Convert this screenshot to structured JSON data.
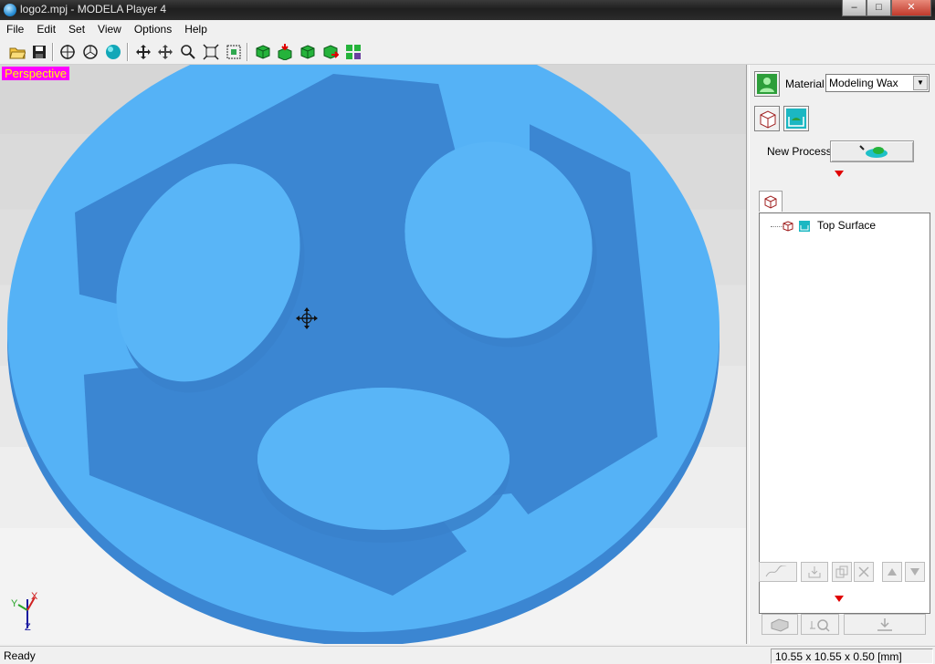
{
  "window": {
    "title": "logo2.mpj - MODELA Player 4",
    "min_label": "–",
    "max_label": "□",
    "close_label": "✕"
  },
  "menu": [
    "File",
    "Edit",
    "Set",
    "View",
    "Options",
    "Help"
  ],
  "toolbar": {
    "buttons": [
      "open-icon",
      "save-icon",
      "view-front-icon",
      "view-side-icon",
      "sphere-render-icon",
      "move-icon",
      "pan-icon",
      "zoom-icon",
      "fit-icon",
      "zoom-box-icon",
      "cube-green-icon",
      "cube-down-icon",
      "cube-right-icon",
      "cube-red-icon",
      "grid-icon"
    ]
  },
  "viewport": {
    "label": "Perspective",
    "axis": {
      "x": "X",
      "y": "Y",
      "z": "Z"
    }
  },
  "panel": {
    "material_label": "Material",
    "material_value": "Modeling Wax",
    "new_process_label": "New Process",
    "tree": [
      {
        "label": "Top Surface"
      }
    ]
  },
  "status": {
    "text": "Ready",
    "dimensions": "10.55 x 10.55 x 0.50 [mm]"
  },
  "colors": {
    "model_top": "#55b2f6",
    "model_side": "#3a8ee0",
    "view_label_bg": "#ff00ff",
    "view_label_fg": "#ffff00"
  }
}
